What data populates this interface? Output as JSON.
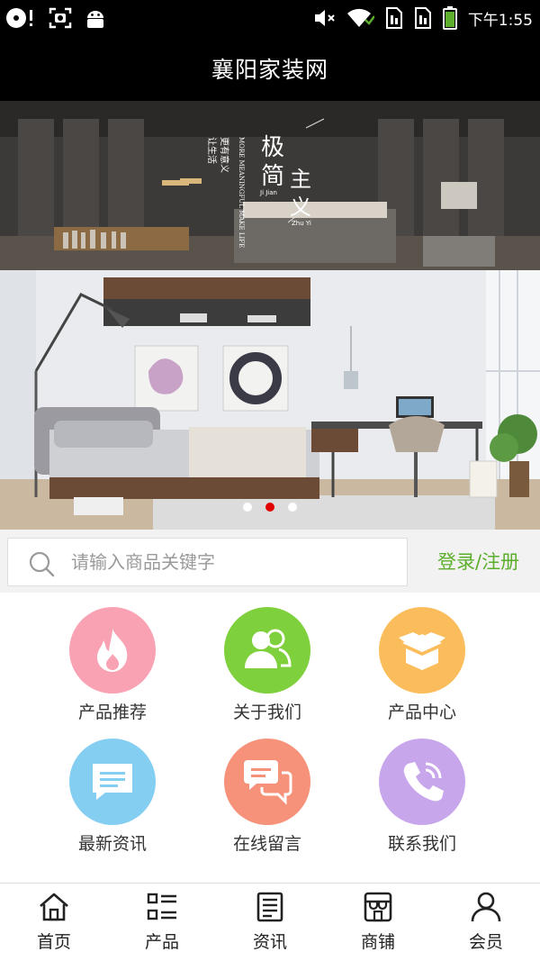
{
  "status_bar": {
    "time": "下午1:55",
    "icons": [
      "disc-icon",
      "screenshot-icon",
      "android-icon",
      "mute-icon",
      "wifi-icon",
      "sim1-icon",
      "sim2-icon",
      "battery-icon"
    ]
  },
  "header": {
    "title": "襄阳家装网"
  },
  "banner": {
    "slides": 3,
    "active_slide": 2,
    "poster_text": {
      "title_a": "极",
      "title_b": "简",
      "title_c": "主",
      "title_d": "义",
      "pinyin_a": "Ji Jian",
      "pinyin_b": "Zhu Yi",
      "english": "MORE MEANINGFUL MAKE LIFE",
      "slogan_a": "让生活",
      "slogan_b": "更有意义"
    },
    "dot_colors": {
      "active": "#e00000",
      "inactive": "#ffffff"
    }
  },
  "search": {
    "placeholder": "请输入商品关键字",
    "value": ""
  },
  "login": {
    "label": "登录/注册",
    "color": "#5cae2c"
  },
  "grid": {
    "items": [
      {
        "label": "产品推荐",
        "icon": "flame-icon",
        "color": "#f9a2b3"
      },
      {
        "label": "关于我们",
        "icon": "users-icon",
        "color": "#7ed03c"
      },
      {
        "label": "产品中心",
        "icon": "box-icon",
        "color": "#fbbd5c"
      },
      {
        "label": "最新资讯",
        "icon": "message-icon",
        "color": "#84cef2"
      },
      {
        "label": "在线留言",
        "icon": "chat-bubbles-icon",
        "color": "#f6927a"
      },
      {
        "label": "联系我们",
        "icon": "phone-icon",
        "color": "#c8a6eb"
      }
    ]
  },
  "bottom_nav": {
    "items": [
      {
        "label": "首页",
        "icon": "home-icon"
      },
      {
        "label": "产品",
        "icon": "list-icon"
      },
      {
        "label": "资讯",
        "icon": "news-icon"
      },
      {
        "label": "商铺",
        "icon": "shop-icon"
      },
      {
        "label": "会员",
        "icon": "user-icon"
      }
    ]
  }
}
